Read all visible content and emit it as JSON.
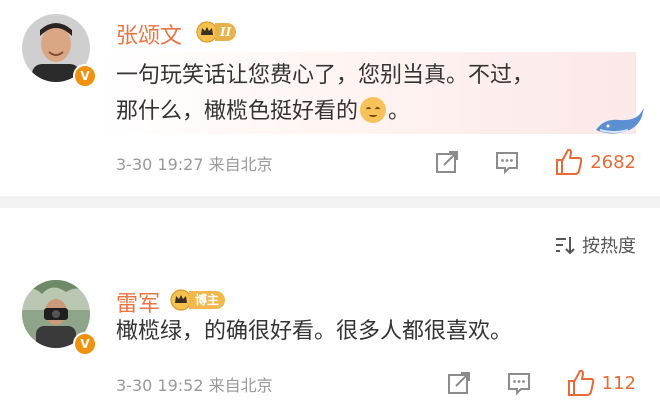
{
  "comments": [
    {
      "username": "张颂文",
      "member_badge": "II",
      "verified_badge": "V",
      "text_line1": "一句玩笑话让您费心了，您别当真。不过，",
      "text_line2_a": "那什么，橄榄色挺好看的",
      "text_line2_b": "。",
      "timestamp": "3-30 19:27",
      "source": "来自北京",
      "like_count": "2682"
    },
    {
      "username": "雷军",
      "member_badge": "博主",
      "verified_badge": "V",
      "text": "橄榄绿，的确很好看。很多人都很喜欢。",
      "timestamp": "3-30 19:52",
      "source": "来自北京",
      "like_count": "112"
    }
  ],
  "sort": {
    "label": "按热度"
  },
  "colors": {
    "username": "#eb7340",
    "like": "#e86a34",
    "badge": "#f0920f",
    "meta": "#999999"
  },
  "icons": [
    "share-icon",
    "comment-icon",
    "thumbs-up-icon",
    "sort-icon",
    "crown-icon",
    "whale-icon",
    "smile-emoji-icon"
  ]
}
